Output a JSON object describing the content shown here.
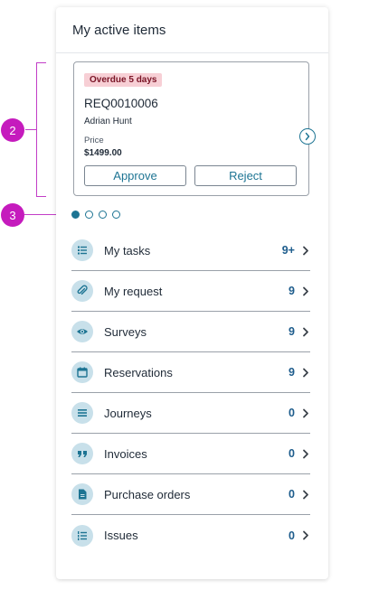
{
  "panel": {
    "title": "My active items"
  },
  "card": {
    "badge": "Overdue 5 days",
    "request_id": "REQ0010006",
    "requester": "Adrian Hunt",
    "price_label": "Price",
    "price_value": "$1499.00",
    "approve_label": "Approve",
    "reject_label": "Reject"
  },
  "carousel": {
    "pages": 4,
    "active_index": 0
  },
  "callouts": {
    "card": "2",
    "dots": "3"
  },
  "list": [
    {
      "label": "My tasks",
      "count": "9+",
      "icon": "list-icon"
    },
    {
      "label": "My request",
      "count": "9",
      "icon": "paperclip-icon"
    },
    {
      "label": "Surveys",
      "count": "9",
      "icon": "eye-icon"
    },
    {
      "label": "Reservations",
      "count": "9",
      "icon": "calendar-icon"
    },
    {
      "label": "Journeys",
      "count": "0",
      "icon": "menu-lines-icon"
    },
    {
      "label": "Invoices",
      "count": "0",
      "icon": "quote-icon"
    },
    {
      "label": "Purchase orders",
      "count": "0",
      "icon": "document-icon"
    },
    {
      "label": "Issues",
      "count": "0",
      "icon": "numbered-list-icon"
    }
  ],
  "colors": {
    "accent": "#1d7493",
    "count": "#1d5c8c",
    "badge_bg": "#f7cfd5",
    "icon_bg": "#c8e0ea",
    "callout": "#c51bbd"
  }
}
